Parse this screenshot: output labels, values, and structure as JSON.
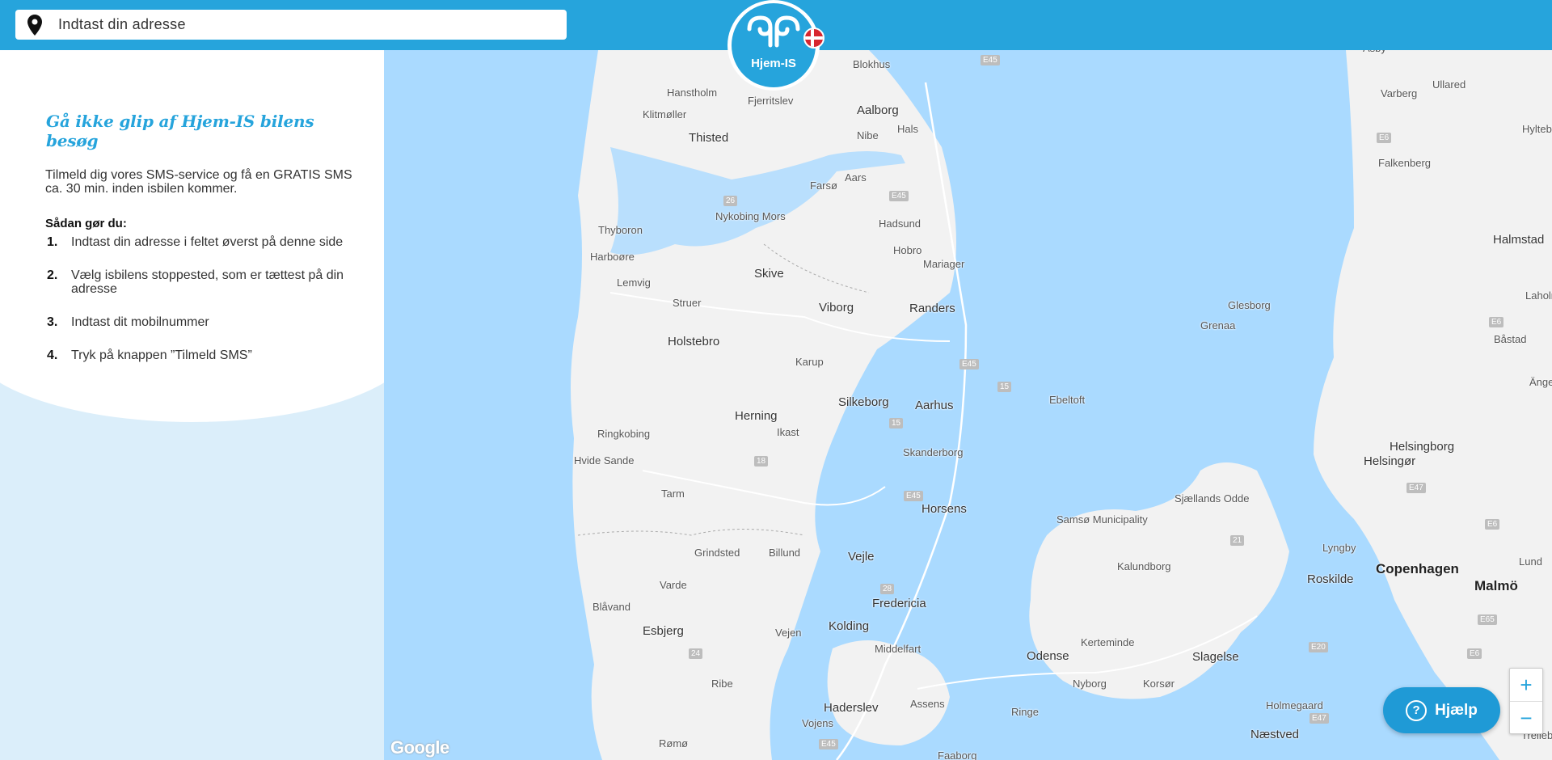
{
  "search": {
    "placeholder": "Indtast din adresse",
    "icon": "map-pin-icon"
  },
  "logo": {
    "text": "Hjem-IS",
    "flag": "denmark-flag"
  },
  "colors": {
    "brand_blue": "#26a4dc",
    "sidebar_bg": "#dbeefa",
    "map_water": "#aadaff",
    "map_land": "#f2f2f2"
  },
  "sidebar": {
    "title": "Gå ikke glip af Hjem-IS bilens besøg",
    "intro": "Tilmeld dig vores SMS-service og få en GRATIS SMS ca. 30 min. inden isbilen kommer.",
    "howto_heading": "Sådan gør du:",
    "steps": [
      {
        "num": "1.",
        "text": "Indtast din adresse i feltet øverst på denne side"
      },
      {
        "num": "2.",
        "text": "Vælg isbilens stoppested, som er tættest på din adresse"
      },
      {
        "num": "3.",
        "text": "Indtast dit mobilnummer"
      },
      {
        "num": "4.",
        "text": "Tryk på knappen ”Tilmeld SMS”"
      }
    ]
  },
  "map": {
    "attribution": "Google",
    "labels": [
      "Blokhus",
      "Hanstholm",
      "Fjerritslev",
      "Klitmøller",
      "Aalborg",
      "Hals",
      "Thisted",
      "Nibe",
      "Aars",
      "Farsø",
      "Nykobing Mors",
      "Hadsund",
      "Thyboron",
      "Hobro",
      "Mariager",
      "Harboøre",
      "Skive",
      "Lemvig",
      "Struer",
      "Viborg",
      "Randers",
      "Glesborg",
      "Grenaa",
      "Holstebro",
      "Karup",
      "Silkeborg",
      "Aarhus",
      "Ebeltoft",
      "Herning",
      "Ikast",
      "Ringkobing",
      "Skanderborg",
      "Hvide Sande",
      "Tarm",
      "Horsens",
      "Samsø Municipality",
      "Sjællands Odde",
      "Grindsted",
      "Billund",
      "Vejle",
      "Varde",
      "Fredericia",
      "Kalundborg",
      "Blåvand",
      "Esbjerg",
      "Vejen",
      "Kolding",
      "Middelfart",
      "Kerteminde",
      "Odense",
      "Slagelse",
      "Ribe",
      "Nyborg",
      "Korsør",
      "Haderslev",
      "Assens",
      "Ringe",
      "Vojens",
      "Rømø",
      "Faaborg",
      "Næstved",
      "Holmegaard",
      "Roskilde",
      "Lyngby",
      "Helsingør",
      "Helsingborg",
      "Copenhagen",
      "Malmö",
      "Lund",
      "Ängelholm",
      "Båstad",
      "Laholm",
      "Halmstad",
      "Falkenberg",
      "Varberg",
      "Ullared",
      "Asby",
      "Hyltebruk",
      "Trelleborg"
    ],
    "roads": [
      "E45",
      "E45",
      "26",
      "E45",
      "15",
      "15",
      "18",
      "E45",
      "28",
      "24",
      "E45",
      "21",
      "E20",
      "E47",
      "E47",
      "E6",
      "E6",
      "E6",
      "E6",
      "E65"
    ]
  },
  "controls": {
    "zoom_in": "+",
    "zoom_out": "−",
    "help_label": "Hjælp"
  }
}
